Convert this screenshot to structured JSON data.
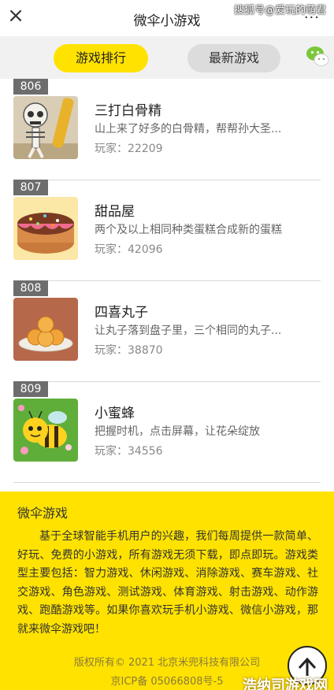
{
  "topbar": {
    "close_label": "×",
    "title": "微伞小游戏",
    "more_label": "···",
    "watermark": "搜狐号@爱玩的萌君"
  },
  "tabs": [
    {
      "label": "游戏排行",
      "active": true
    },
    {
      "label": "最新游戏",
      "active": false
    }
  ],
  "games": [
    {
      "rank": "806",
      "name": "三打白骨精",
      "desc": "山上来了好多的白骨精，帮帮孙大圣...",
      "players": "玩家：22209",
      "thumb": "skeleton-thumb"
    },
    {
      "rank": "807",
      "name": "甜品屋",
      "desc": "两个及以上相同种类蛋糕合成新的蛋糕",
      "players": "玩家：42096",
      "thumb": "cake-thumb"
    },
    {
      "rank": "808",
      "name": "四喜丸子",
      "desc": "让丸子落到盘子里，三个相同的丸子...",
      "players": "玩家：38870",
      "thumb": "meatball-thumb"
    },
    {
      "rank": "809",
      "name": "小蜜蜂",
      "desc": "把握时机，点击屏幕，让花朵绽放",
      "players": "玩家：34556",
      "thumb": "bee-thumb"
    }
  ],
  "footer": {
    "title": "微伞游戏",
    "text": "基于全球智能手机用户的兴趣，我们每周提供一款简单、好玩、免费的小游戏，所有游戏无须下载，即点即玩。游戏类型主要包括：智力游戏、休闲游戏、消除游戏、赛车游戏、社交游戏、角色游戏、测试游戏、体育游戏、射击游戏、动作游戏、跑酷游戏等。如果你喜欢玩手机小游戏、微信小游戏，那就来微伞游戏吧！",
    "copyright": "版权所有© 2021 北京米兜科技有限公司",
    "icp": "京ICP备 05066808号-5",
    "watermark": "浩纳司游戏网"
  },
  "colors": {
    "accent": "#ffe200",
    "badge": "#6d6d6d",
    "tabbar_bg": "#f1f1f1"
  }
}
